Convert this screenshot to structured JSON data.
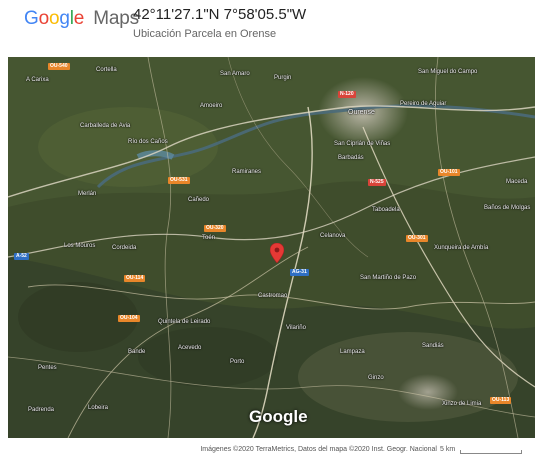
{
  "header": {
    "logo_text": "Google Maps",
    "coordinates": "42°11'27.1\"N 7°58'05.5\"W",
    "subtitle": "Ubicación Parcela en Orense"
  },
  "map": {
    "type": "satellite",
    "watermark": "Google",
    "pin_icon": "location-pin-icon",
    "pin_color": "#e53935",
    "labels": [
      "A Carixa",
      "Cortella",
      "San Amaro",
      "Purgin",
      "Ourense",
      "San Miguel do Campo",
      "Carballeda de Avia",
      "Río dos Caños",
      "Amoeiro",
      "Barbadás",
      "Pereiro de Aguiar",
      "San Ciprián de Viñas",
      "Ramiranes",
      "Taboadela",
      "Cañedo",
      "Maceda",
      "Los Mouros",
      "Cordeida",
      "Merlán",
      "Toén",
      "Celanova",
      "Baños de Molgas",
      "San Martiño de Pazo",
      "Castromao",
      "Xunqueira de Ambía",
      "Quintela de Leirado",
      "Lampaza",
      "Acevedo",
      "Sandiás",
      "Bande",
      "Pentes",
      "Lobeira",
      "Porto",
      "Vilariño",
      "Ginzo",
      "Xinzo de Limia",
      "Padrenda"
    ],
    "road_shields": [
      {
        "label": "N-120",
        "color": "red"
      },
      {
        "label": "N-525",
        "color": "red"
      },
      {
        "label": "A-52",
        "color": "blue"
      },
      {
        "label": "AG-31",
        "color": "blue"
      },
      {
        "label": "OU-540",
        "color": "orange"
      },
      {
        "label": "OU-531",
        "color": "orange"
      },
      {
        "label": "OU-320",
        "color": "orange"
      },
      {
        "label": "OU-101",
        "color": "orange"
      },
      {
        "label": "OU-114",
        "color": "orange"
      },
      {
        "label": "OU-104",
        "color": "orange"
      },
      {
        "label": "OU-301",
        "color": "orange"
      },
      {
        "label": "OU-113",
        "color": "orange"
      }
    ]
  },
  "footer": {
    "attribution": "Imágenes ©2020 TerraMetrics, Datos del mapa ©2020 Inst. Geogr. Nacional",
    "scale": "5 km"
  }
}
